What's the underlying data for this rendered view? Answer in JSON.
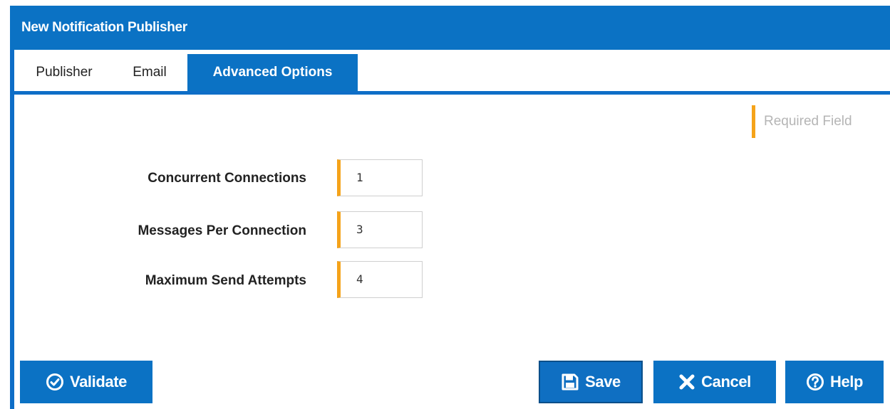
{
  "dialog": {
    "title": "New Notification Publisher",
    "tabs": [
      {
        "label": "Publisher"
      },
      {
        "label": "Email"
      },
      {
        "label": "Advanced Options"
      }
    ],
    "required_label": "Required Field",
    "fields": [
      {
        "label": "Concurrent Connections",
        "value": "1"
      },
      {
        "label": "Messages Per Connection",
        "value": "3"
      },
      {
        "label": "Maximum Send Attempts",
        "value": "4"
      }
    ],
    "buttons": {
      "validate": "Validate",
      "save": "Save",
      "cancel": "Cancel",
      "help": "Help"
    }
  },
  "colors": {
    "primary": "#0b72c4",
    "required_accent": "#f5a31a"
  },
  "icons": {
    "validate": "check-circle-icon",
    "save": "floppy-disk-icon",
    "cancel": "x-icon",
    "help": "question-circle-icon"
  }
}
